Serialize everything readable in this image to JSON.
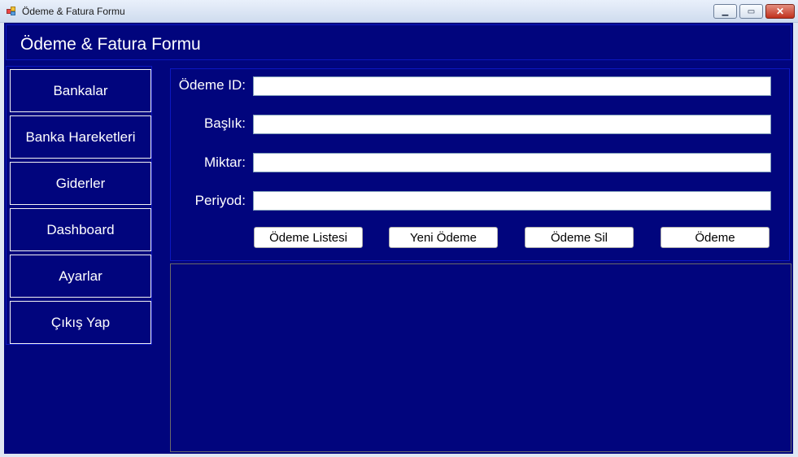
{
  "window": {
    "title": "Ödeme & Fatura Formu",
    "controls": {
      "minimize_icon": "minimize-icon",
      "maximize_icon": "maximize-icon",
      "close_icon": "close-icon"
    }
  },
  "header": {
    "title": "Ödeme & Fatura Formu"
  },
  "sidebar": {
    "items": [
      {
        "label": "Bankalar"
      },
      {
        "label": "Banka Hareketleri"
      },
      {
        "label": "Giderler"
      },
      {
        "label": "Dashboard"
      },
      {
        "label": "Ayarlar"
      },
      {
        "label": "Çıkış Yap"
      }
    ]
  },
  "form": {
    "fields": [
      {
        "label": "Ödeme ID:",
        "value": ""
      },
      {
        "label": "Başlık:",
        "value": ""
      },
      {
        "label": "Miktar:",
        "value": ""
      },
      {
        "label": "Periyod:",
        "value": ""
      }
    ],
    "buttons": [
      {
        "label": "Ödeme Listesi"
      },
      {
        "label": "Yeni Ödeme"
      },
      {
        "label": "Ödeme Sil"
      },
      {
        "label": "Ödeme"
      }
    ]
  },
  "colors": {
    "background": "#01057d",
    "panel_border": "#0c17c0",
    "text": "#ffffff"
  }
}
